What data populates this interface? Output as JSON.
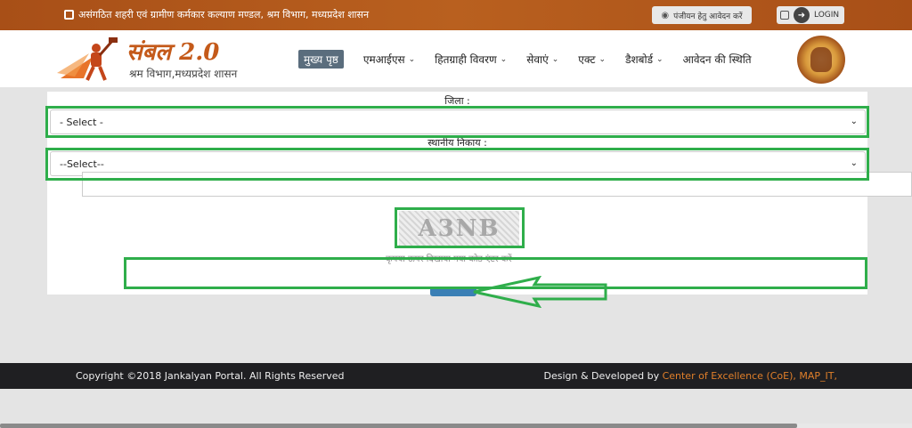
{
  "topbar": {
    "ministry_text": "असंगठित शहरी एवं ग्रामीण कर्मकार कल्याण मण्डल, श्रम विभाग, मध्यप्रदेश शासन",
    "register_label": "पंजीयन हेतु आवेदन करें",
    "login_label": "LOGIN"
  },
  "header": {
    "logo_title": "संबल 2.0",
    "logo_sub": "श्रम  विभाग,मध्यप्रदेश  शासन",
    "nav": [
      {
        "label": "मुख्य पृष्ठ"
      },
      {
        "label": "एमआईएस"
      },
      {
        "label": "हितग्राही विवरण"
      },
      {
        "label": "सेवाएं"
      },
      {
        "label": "एक्ट"
      },
      {
        "label": "डैशबोर्ड"
      },
      {
        "label": "आवेदन की स्थिति"
      }
    ]
  },
  "form": {
    "district_label": "जिला :",
    "district_value": "- Select -",
    "local_body_label": "स्थानीय निकाय :",
    "local_body_value": "--Select--",
    "captcha_text": "A3NB",
    "captcha_hint": "कृपया ऊपर दिखाया गया कोड एंटर करें",
    "captcha_input_value": ""
  },
  "footer": {
    "copyright": "Copyright ©2018 Jankalyan Portal. All Rights Reserved",
    "dev_prefix": "Design & Developed by ",
    "dev_link": "Center of Excellence (CoE), MAP_IT,"
  },
  "colors": {
    "topbar": "#b35a1e",
    "highlight": "#2fae4b",
    "footer": "#1f1f22",
    "accent": "#e07f2a"
  }
}
